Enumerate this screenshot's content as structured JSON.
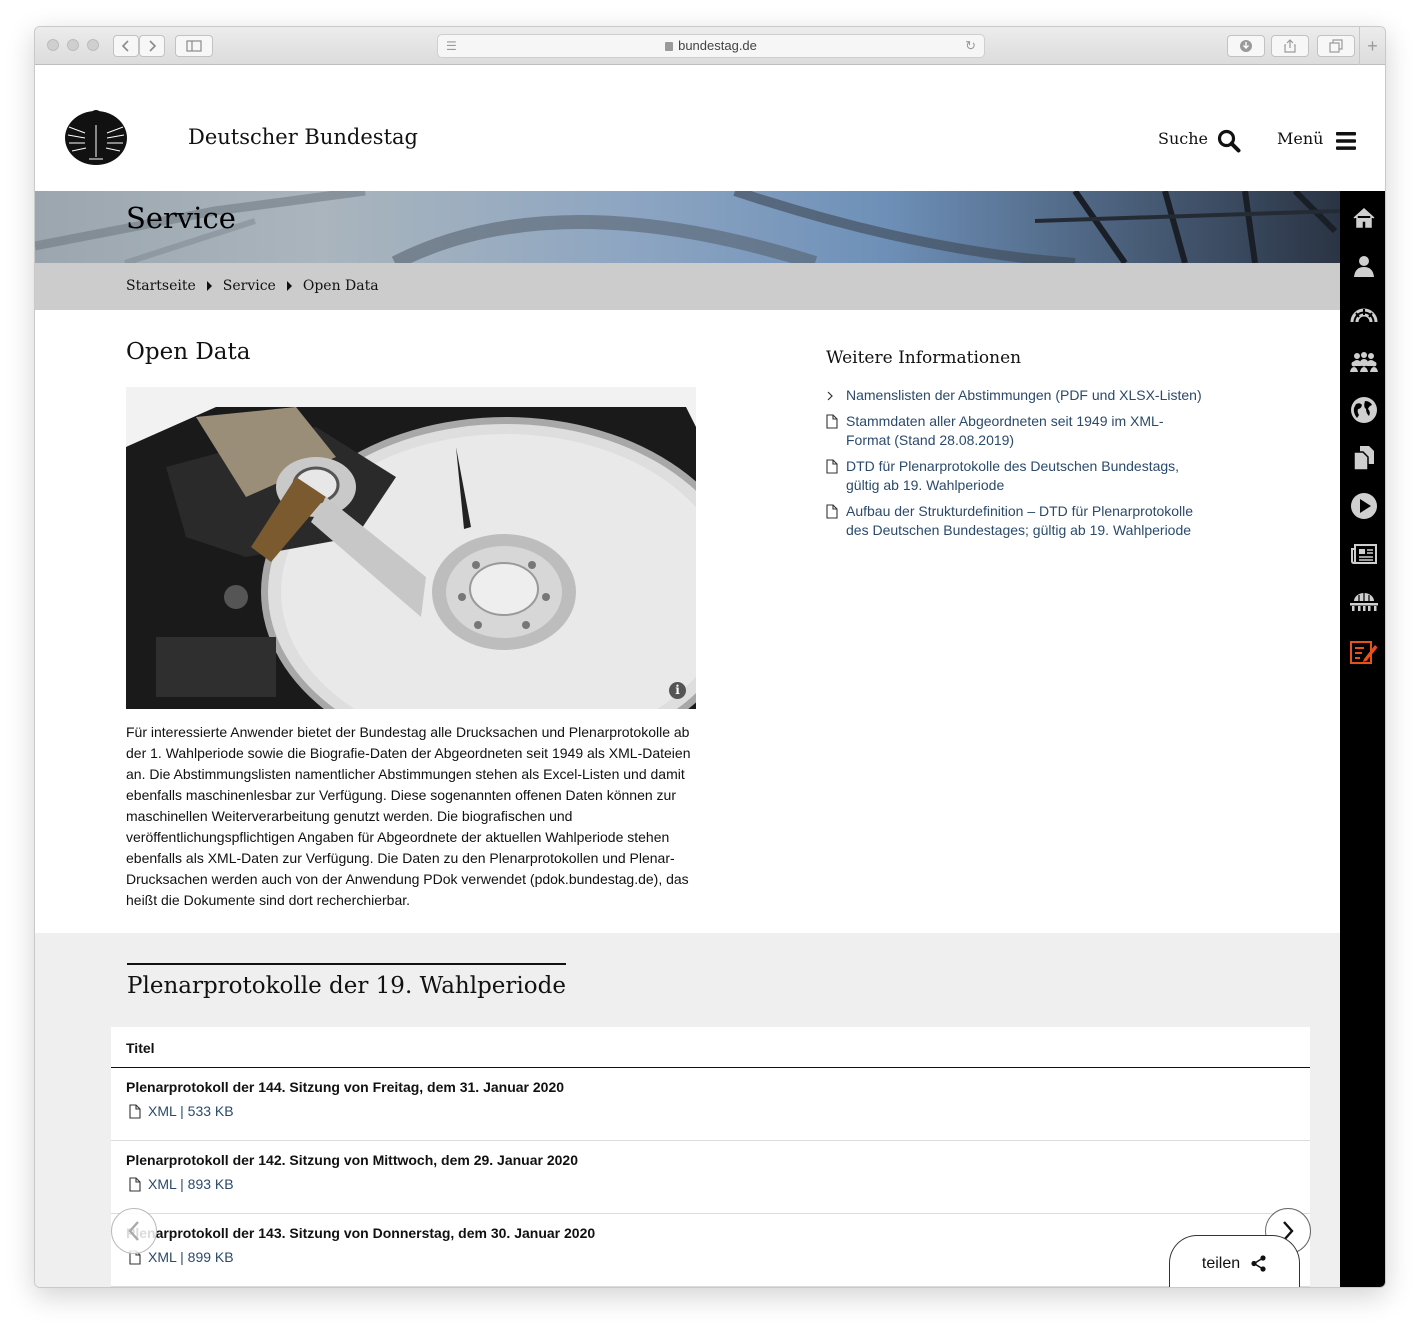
{
  "browser": {
    "url": "bundestag.de"
  },
  "header": {
    "site_title": "Deutscher Bundestag",
    "search_label": "Suche",
    "menu_label": "Menü"
  },
  "hero": {
    "title": "Service"
  },
  "breadcrumb": {
    "items": [
      "Startseite",
      "Service",
      "Open Data"
    ]
  },
  "main": {
    "title": "Open Data",
    "body": "Für interessierte Anwender bietet der Bundestag alle Drucksachen und Plenarprotokolle ab der 1. Wahlperiode sowie die Biografie-Daten der Abgeordneten seit 1949 als XML-Dateien an. Die Abstimmungslisten namentlicher Abstimmungen stehen als Excel-Listen und damit ebenfalls maschinenlesbar zur Verfügung. Diese sogenannten offenen Daten können zur maschinellen Weiterverarbeitung genutzt werden. Die biografischen und veröffentlichungspflichtigen Angaben für Abgeordnete der aktuellen Wahlperiode stehen ebenfalls als XML-Daten zur Verfügung. Die Daten zu den Plenarprotokollen und Plenar-Drucksachen werden auch von der Anwendung PDok verwendet (pdok.bundestag.de), das heißt die Dokumente sind dort recherchierbar."
  },
  "weitere": {
    "title": "Weitere Informationen",
    "links": [
      {
        "label": "Namenslisten der Abstimmungen (PDF und XLSX-Listen)",
        "icon": "chevron-right-icon"
      },
      {
        "label": "Stammdaten aller Abgeordneten seit 1949 im XML-Format (Stand 28.08.2019)",
        "icon": "file-icon"
      },
      {
        "label": "DTD für Plenarprotokolle des Deutschen Bundestags, gültig ab 19. Wahlperiode",
        "icon": "file-icon"
      },
      {
        "label": "Aufbau der Strukturdefinition – DTD für Plenarprotokolle des Deutschen Bundestages; gültig ab 19. Wahlperiode",
        "icon": "file-icon"
      }
    ]
  },
  "plenar": {
    "title": "Plenarprotokolle der 19. Wahlperiode",
    "column_header": "Titel",
    "rows": [
      {
        "title": "Plenarprotokoll der 144. Sitzung von Freitag, dem 31. Januar 2020",
        "link": "XML | 533 KB"
      },
      {
        "title": "Plenarprotokoll der 142. Sitzung von Mittwoch, dem 29. Januar 2020",
        "link": "XML | 893 KB"
      },
      {
        "title": "Plenarprotokoll der 143. Sitzung von Donnerstag, dem 30. Januar 2020",
        "link": "XML | 899 KB"
      }
    ]
  },
  "share": {
    "label": "teilen"
  },
  "sidebar": {
    "icons": [
      "home-icon",
      "person-icon",
      "plenary-icon",
      "group-icon",
      "globe-icon",
      "documents-icon",
      "play-icon",
      "newspaper-icon",
      "building-icon",
      "edit-icon"
    ],
    "active_color": "#e8501c"
  }
}
